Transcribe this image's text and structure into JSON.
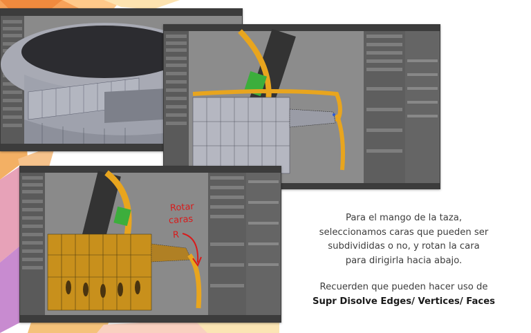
{
  "slide": {
    "paragraph_lines": [
      "Para el mango de la taza,",
      "seleccionamos caras que pueden ser",
      "subdivididas o no, y rotan la cara",
      "para dirigirla hacia abajo."
    ],
    "tip_line": "Recuerden que pueden hacer uso de",
    "tip_bold": "Supr Disolve Edges/ Vertices/ Faces"
  },
  "screenshots": [
    {
      "description_icon": "blender-3d-viewport-icon",
      "view": "mug rim top view"
    },
    {
      "description_icon": "blender-3d-viewport-icon",
      "view": "mug handle extruded faces"
    },
    {
      "description_icon": "blender-3d-viewport-icon",
      "view": "mug handle rotated faces"
    }
  ],
  "annotation": {
    "line1": "Rotar",
    "line2": "caras",
    "key": "R",
    "color": "#d81b1b"
  },
  "colors": {
    "handle_orange": "#e89d1e",
    "blender_gray": "#6e6e6e",
    "panel_dark": "#3c3c3c"
  }
}
